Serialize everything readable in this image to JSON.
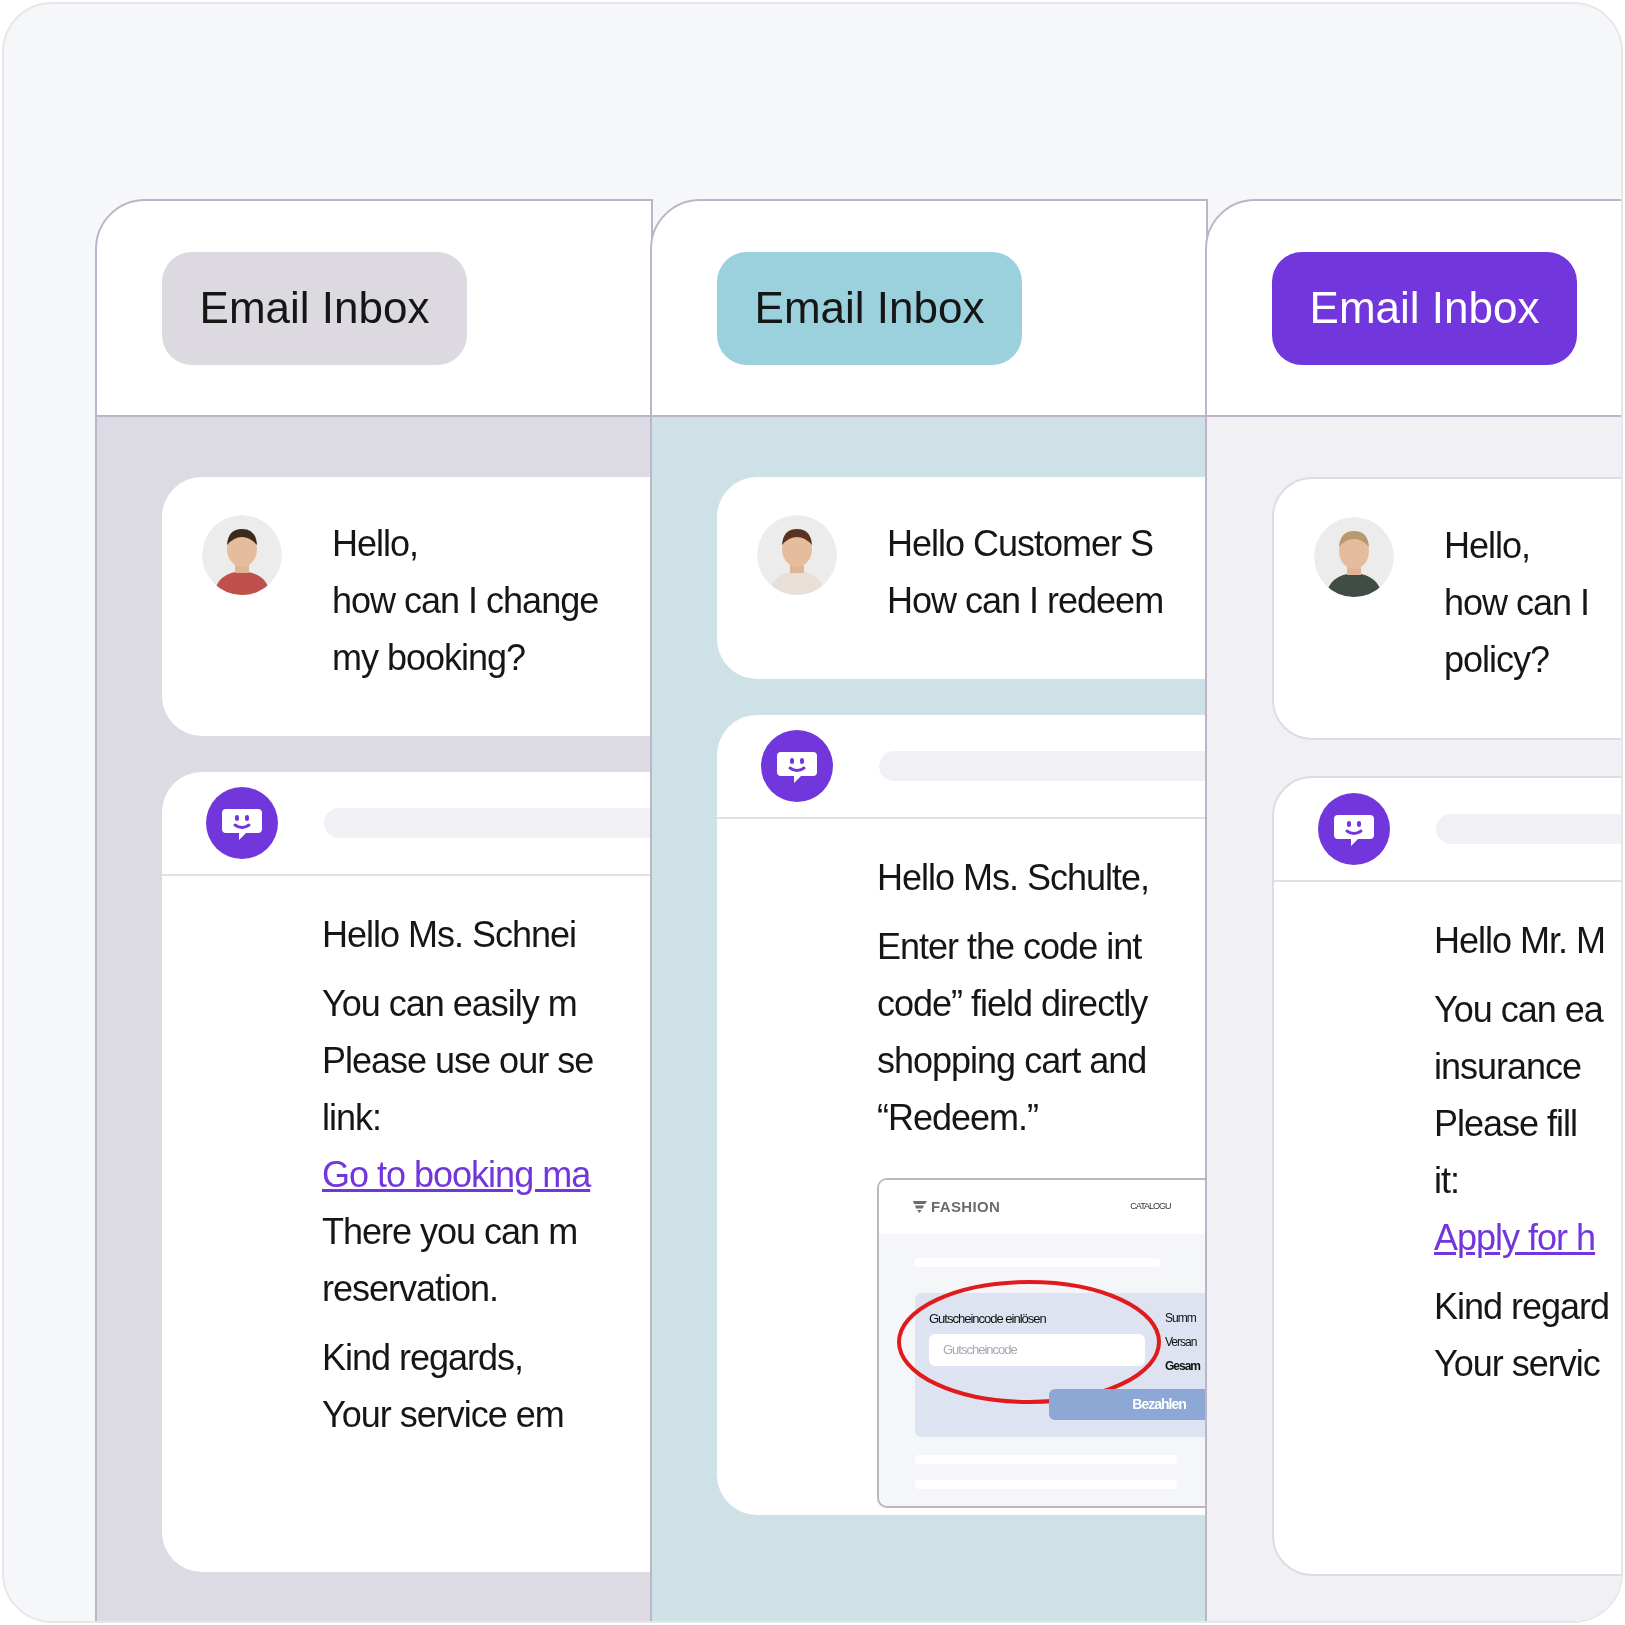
{
  "panels": [
    {
      "body": {
        "color": "#dcdae3"
      },
      "bordered": false,
      "button": {
        "label": "Email Inbox",
        "color": "#ddd9e0"
      },
      "customer": [
        "Hello,",
        "how can I change",
        "my booking?"
      ],
      "reply": [
        [
          {
            "kind": "text",
            "text": "Hello Ms. Schnei"
          }
        ],
        [
          {
            "kind": "text",
            "text": "You can easily m"
          },
          {
            "kind": "text",
            "text": "Please use our se"
          },
          {
            "kind": "text",
            "text": "link:"
          },
          {
            "kind": "link",
            "text": "Go to booking ma"
          },
          {
            "kind": "text",
            "text": "There you can m"
          },
          {
            "kind": "text",
            "text": "reservation."
          }
        ],
        [
          {
            "kind": "text",
            "text": "Kind regards,"
          },
          {
            "kind": "text",
            "text": "Your service em"
          }
        ]
      ]
    },
    {
      "body": {
        "color": "#cde1e7"
      },
      "bordered": false,
      "button": {
        "label": "Email Inbox",
        "color": "#9bd0dd"
      },
      "customer": [
        "Hello Customer S",
        "How can I redeem"
      ],
      "reply": [
        [
          {
            "kind": "text",
            "text": "Hello Ms. Schulte,"
          }
        ],
        [
          {
            "kind": "text",
            "text": "Enter the code int"
          },
          {
            "kind": "text",
            "text": "code” field directly"
          },
          {
            "kind": "text",
            "text": "shopping cart and"
          },
          {
            "kind": "text",
            "text": "“Redeem.”"
          }
        ]
      ],
      "screenshot": {
        "logo": "FASHION",
        "nav": "CATALOGU",
        "label": "Gutscheincode einlösen",
        "placeholder": "Gutscheincode",
        "totals": [
          "Summ",
          "Versan",
          "Gesam"
        ],
        "button": "Bezahlen"
      }
    },
    {
      "body": {
        "color": "#f1f0f4"
      },
      "bordered": true,
      "button": {
        "label": "Email Inbox",
        "color": "#7236dd"
      },
      "customer": [
        "Hello,",
        "how can I",
        "policy?"
      ],
      "reply": [
        [
          {
            "kind": "text",
            "text": "Hello Mr. M"
          }
        ],
        [
          {
            "kind": "text",
            "text": "You can ea"
          },
          {
            "kind": "text",
            "text": "insurance"
          },
          {
            "kind": "text",
            "text": "Please fill"
          },
          {
            "kind": "text",
            "text": "it:"
          },
          {
            "kind": "link",
            "text": "Apply for h"
          }
        ],
        [
          {
            "kind": "text",
            "text": "Kind regard"
          },
          {
            "kind": "text",
            "text": "Your servic"
          }
        ]
      ]
    }
  ]
}
